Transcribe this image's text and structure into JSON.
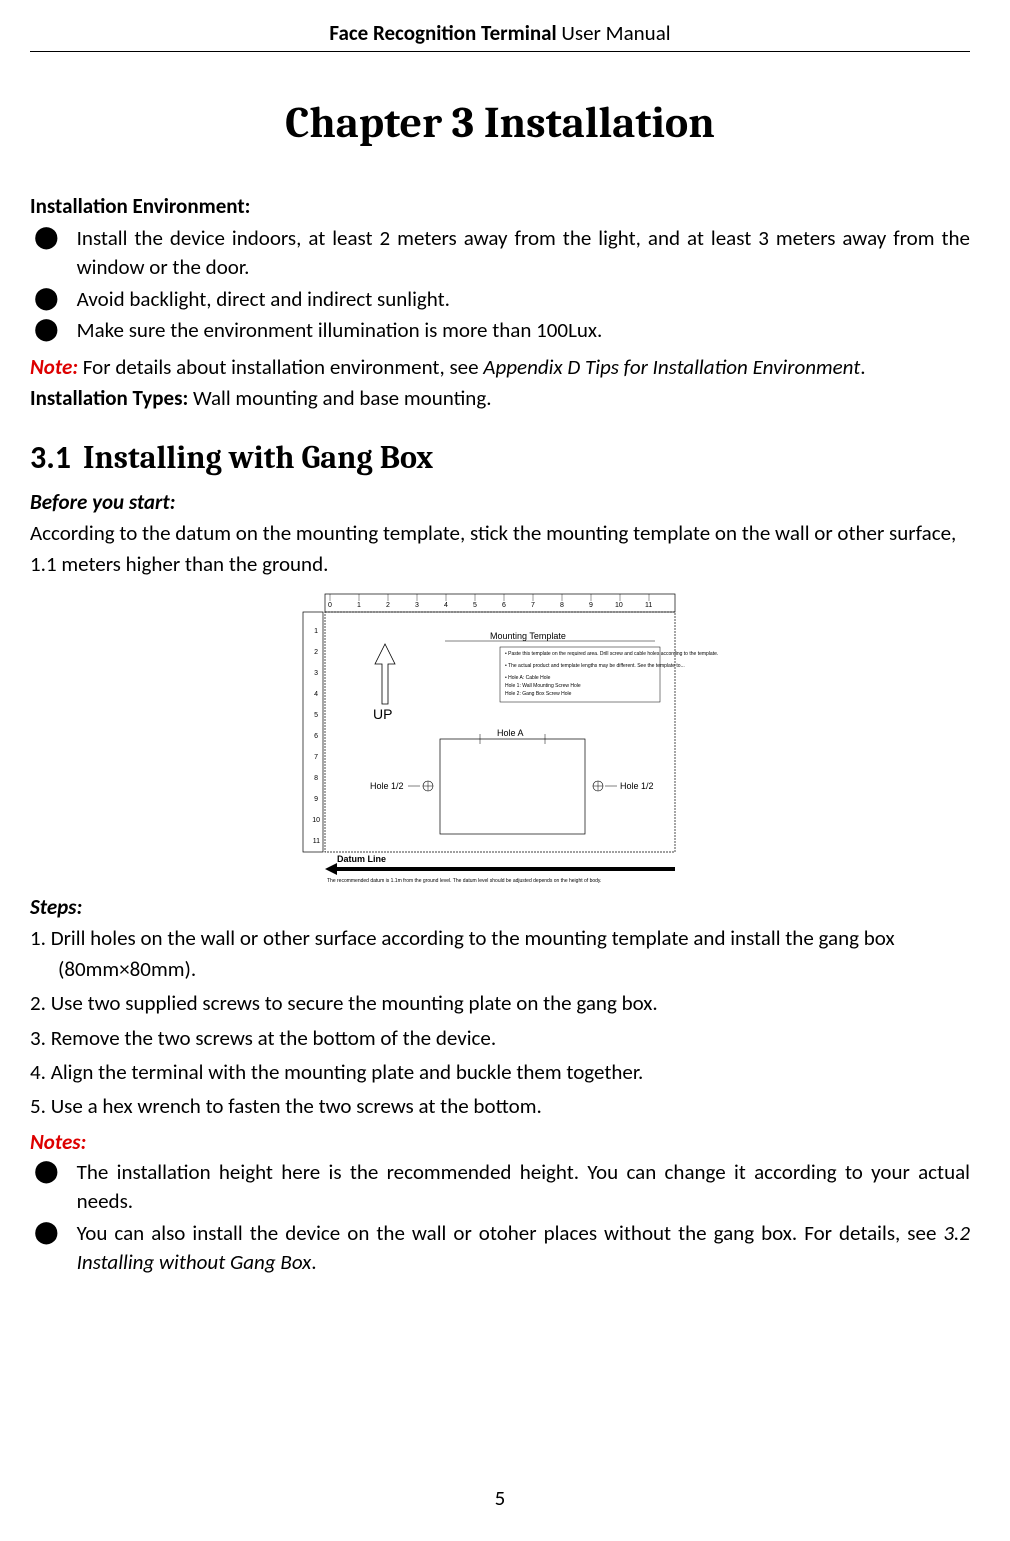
{
  "header": {
    "bold": "Face Recognition Terminal",
    "normal": "  User Manual"
  },
  "chapter_title": "Chapter 3  Installation",
  "env": {
    "heading": "Installation Environment:",
    "bullets": [
      "Install the device indoors, at least 2 meters away from the light, and at least 3 meters away from the window or the door.",
      "Avoid backlight, direct and indirect sunlight.",
      "Make sure the environment illumination is more than 100Lux."
    ],
    "note_label": "Note:",
    "note_text": " For details about installation environment, see ",
    "note_ref": "Appendix D Tips for Installation Environment",
    "note_end": "."
  },
  "types": {
    "label": "Installation Types:",
    "text": " Wall mounting and base mounting."
  },
  "subsection": {
    "num": "3.1",
    "title": "Installing with Gang Box"
  },
  "before_start": {
    "heading": "Before you start:",
    "text": "According to the datum on the mounting template, stick the mounting template on the wall or other surface, 1.1 meters higher than the ground."
  },
  "diagram": {
    "up_label": "UP",
    "template_label": "Mounting Template",
    "hole_a": "Hole A",
    "hole_left": "Hole 1/2",
    "hole_right": "Hole 1/2",
    "datum_label": "Datum Line",
    "ruler_ticks": [
      "0",
      "1",
      "2",
      "3",
      "4",
      "5",
      "6",
      "7",
      "8",
      "9",
      "10",
      "11"
    ],
    "ruler_side": [
      "1",
      "2",
      "3",
      "4",
      "5",
      "6",
      "7",
      "8",
      "9",
      "10",
      "11"
    ],
    "notes": [
      "• Paste this template on the required area. Drill screw and cable holes according to the template.",
      "• The actual product and template lengths may be different. See the template to...",
      "• Hole A: Cable Hole",
      "  Hole 1: Wall Mounting Screw Hole",
      "  Hole 2: Gang Box Screw Hole"
    ],
    "bottom_note": "The recommended datum is 1.1m from the ground level. The datum level should be adjusted depends on the height of body."
  },
  "steps": {
    "heading": "Steps:",
    "items": [
      "1. Drill holes on the wall or other surface according to the mounting template and install the gang box (80mm×80mm).",
      "2. Use two supplied screws to secure the mounting plate on the gang box.",
      "3. Remove the two screws at the bottom of the device.",
      "4. Align the terminal with the mounting plate and buckle them together.",
      "5. Use a hex wrench to fasten the two screws at the bottom."
    ]
  },
  "notes_section": {
    "heading": "Notes:",
    "bullets": [
      "The installation height here is the recommended height. You can change it according to your actual needs.",
      "You can also install the device on the wall or otoher places without the gang box. For details, see "
    ],
    "ref": "3.2 Installing without Gang Box",
    "ref_end": "."
  },
  "page_number": "5"
}
